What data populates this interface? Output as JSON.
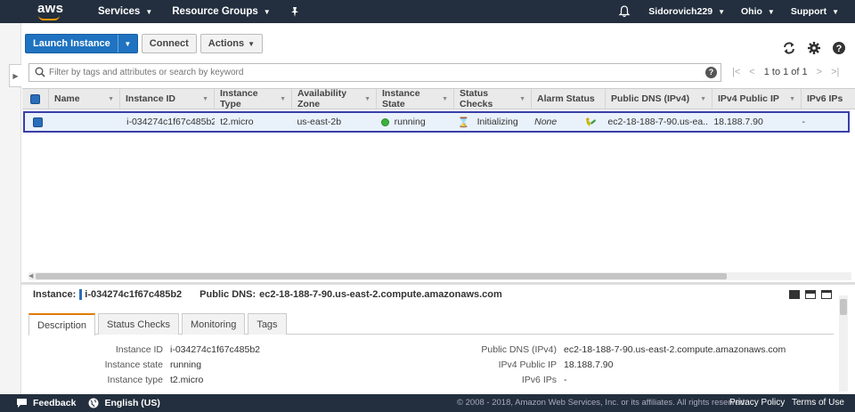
{
  "nav": {
    "logo": "aws",
    "services": "Services",
    "resource_groups": "Resource Groups",
    "user": "Sidorovich229",
    "region": "Ohio",
    "support": "Support"
  },
  "toolbar": {
    "launch": "Launch Instance",
    "connect": "Connect",
    "actions": "Actions"
  },
  "search": {
    "placeholder": "Filter by tags and attributes or search by keyword"
  },
  "pager": {
    "text": "1 to 1 of 1"
  },
  "table": {
    "columns": [
      "Name",
      "Instance ID",
      "Instance Type",
      "Availability Zone",
      "Instance State",
      "Status Checks",
      "Alarm Status",
      "Public DNS (IPv4)",
      "IPv4 Public IP",
      "IPv6 IPs"
    ],
    "row": {
      "name": "",
      "instance_id": "i-034274c1f67c485b2",
      "instance_type": "t2.micro",
      "az": "us-east-2b",
      "state": "running",
      "status_checks": "Initializing",
      "alarm_status": "None",
      "public_dns": "ec2-18-188-7-90.us-ea...",
      "ipv4": "18.188.7.90",
      "ipv6": "-"
    }
  },
  "detail": {
    "instance_label": "Instance:",
    "instance_id": "i-034274c1f67c485b2",
    "dns_label": "Public DNS:",
    "dns_value": "ec2-18-188-7-90.us-east-2.compute.amazonaws.com",
    "tabs": [
      "Description",
      "Status Checks",
      "Monitoring",
      "Tags"
    ],
    "left_props": [
      {
        "k": "Instance ID",
        "v": "i-034274c1f67c485b2"
      },
      {
        "k": "Instance state",
        "v": "running"
      },
      {
        "k": "Instance type",
        "v": "t2.micro"
      }
    ],
    "right_props": [
      {
        "k": "Public DNS (IPv4)",
        "v": "ec2-18-188-7-90.us-east-2.compute.amazonaws.com"
      },
      {
        "k": "IPv4 Public IP",
        "v": "18.188.7.90"
      },
      {
        "k": "IPv6 IPs",
        "v": "-"
      }
    ]
  },
  "footer": {
    "feedback": "Feedback",
    "language": "English (US)",
    "copyright": "© 2008 - 2018, Amazon Web Services, Inc. or its affiliates. All rights reserved.",
    "privacy": "Privacy Policy",
    "terms": "Terms of Use"
  },
  "colors": {
    "nav_bg": "#232f3e",
    "primary": "#1f73c0",
    "accent": "#ff9900",
    "running": "#3cb13c"
  }
}
